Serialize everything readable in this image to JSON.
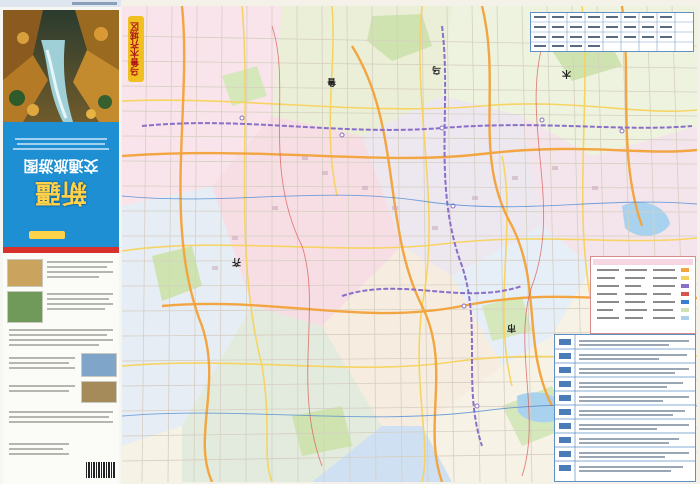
{
  "cover": {
    "title_main": "新疆",
    "title_sub": "交通旅游图",
    "colors": {
      "panel_blue": "#1d8fd2",
      "title_yellow": "#ffd24a",
      "accent_red": "#d8302a"
    }
  },
  "map": {
    "badge_text": "乌鲁木齐城区",
    "labels": [
      {
        "text": "乌",
        "pos": "north"
      },
      {
        "text": "鲁",
        "pos": "north"
      },
      {
        "text": "木",
        "pos": "east"
      },
      {
        "text": "齐",
        "pos": "center"
      },
      {
        "text": "市",
        "pos": "south"
      }
    ],
    "colors": {
      "background": "#f7f2e6",
      "green_area": "#cfe3b0",
      "pink_area": "#f7d6e4",
      "blue_area": "#cfe0f2",
      "water": "#a9d2ee",
      "road_major": "#f2a541",
      "road_secondary": "#f7d35d",
      "metro": "#8a6fc8",
      "street": "#d6cfc2"
    }
  }
}
